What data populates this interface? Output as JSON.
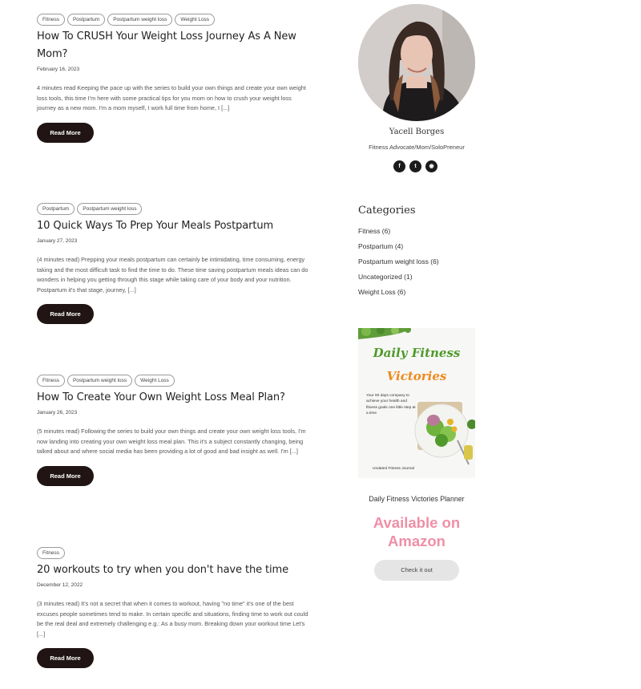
{
  "posts": [
    {
      "tags": [
        "Fitness",
        "Postpartum",
        "Postpartum weight loss",
        "Weight Loss"
      ],
      "title": "How To CRUSH Your Weight Loss Journey As A New Mom?",
      "date": "February 16, 2023",
      "excerpt": "4 minutes read Keeping the pace up with the series to build your own things and create your own weight loss tools, this time I'm here with some practical tips for you mom on how to crush your weight loss journey as a new mom. I'm a mom myself, I work full time from home, I [...]",
      "read_more": "Read More"
    },
    {
      "tags": [
        "Postpartum",
        "Postpartum weight loss"
      ],
      "title": "10 Quick Ways To Prep Your Meals Postpartum",
      "date": "January 27, 2023",
      "excerpt": "(4 minutes read) Prepping your meals postpartum can certainly be intimidating, time consuming, energy taking and the most difficult task to find the time to do. These time saving postpartum meals ideas can do wonders in helping you getting through this stage while taking care of your body and your nutrition. Postpartum it's that stage, journey, [...]",
      "read_more": "Read More"
    },
    {
      "tags": [
        "Fitness",
        "Postpartum weight loss",
        "Weight Loss"
      ],
      "title": "How To Create Your Own Weight Loss Meal Plan?",
      "date": "January 26, 2023",
      "excerpt": "(5 minutes read) Following the series to build your own things and create your own weight loss tools, I'm now landing into creating your own weight loss meal plan. This it's a subject constantly changing, being talked about and where social media has been providing a lot of good and bad insight as well. I'm [...]",
      "read_more": "Read More"
    },
    {
      "tags": [
        "Fitness"
      ],
      "title": "20 workouts to try when you don't have the time",
      "date": "December 12, 2022",
      "excerpt": "(3 minutes read) It's not a secret that when it comes to workout, having \"no time\" it's one of the best excuses people sometimes tend to make. In certain specific and situations, finding time to work out could be the real deal and extremely challenging e.g.: As a busy mom. Breaking down your workout time Let's [...]",
      "read_more": "Read More"
    }
  ],
  "sidebar": {
    "author_name": "Yacell Borges",
    "author_role": "Fitness Advocate/Mom/SoloPreneur",
    "socials": [
      {
        "icon": "facebook-icon",
        "glyph": "f"
      },
      {
        "icon": "twitter-icon",
        "glyph": "t"
      },
      {
        "icon": "rss-icon",
        "glyph": "◉"
      }
    ],
    "categories_title": "Categories",
    "categories": [
      "Fitness (6)",
      "Postpartum (4)",
      "Postpartum weight loss (6)",
      "Uncategorized (1)",
      "Weight Loss (6)"
    ],
    "planner": {
      "title_line1": "Daily Fitness",
      "title_line2": "Victories",
      "description": "Your 90 days company to achieve your health and fitness goals one little step at a time",
      "footer": "Undated Fitness Journal",
      "caption": "Daily Fitness Victories Planner",
      "availability": "Available on Amazon",
      "button": "Check it out"
    }
  },
  "colors": {
    "button_dark": "#211414",
    "planner_green": "#4f9a2a",
    "planner_orange": "#ee8a1d",
    "amazon_pink": "#ef8fa7"
  }
}
